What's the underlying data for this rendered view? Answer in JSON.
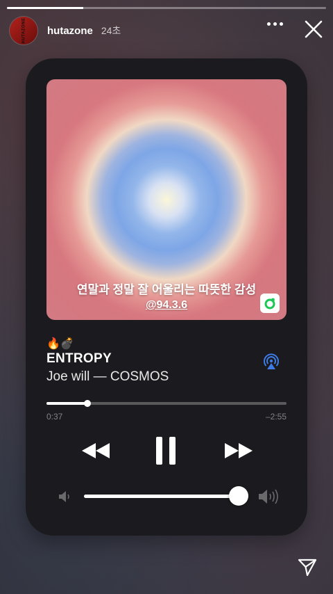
{
  "story": {
    "progress": 0.24,
    "username": "hutazone",
    "time_ago": "24초",
    "avatar_text": "HUTAZONE"
  },
  "player": {
    "artwork": {
      "line1": "연말과 정말 잘 어울리는 따뜻한 감성",
      "line2": "@94.3.6"
    },
    "emoji": "🔥💣",
    "title": "ENTROPY",
    "artist_album": "Joe will — COSMOS",
    "elapsed": "0:37",
    "remaining": "–2:55",
    "position_fraction": 0.17,
    "volume_fraction": 0.98
  },
  "icons": {
    "more": "more-horizontal-icon",
    "close": "close-icon",
    "airplay": "airplay-icon",
    "rewind": "rewind-icon",
    "pause": "pause-icon",
    "fast_forward": "fast-forward-icon",
    "volume_low": "volume-low-icon",
    "volume_high": "volume-high-icon",
    "share": "send-icon",
    "badge": "melon-badge-icon"
  },
  "colors": {
    "airplay_accent": "#3d7be5",
    "badge_green": "#1ec655"
  }
}
